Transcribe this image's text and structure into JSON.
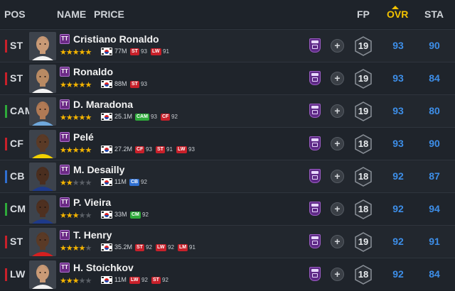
{
  "header": {
    "pos": "POS",
    "name": "NAME",
    "price": "PRICE",
    "fp": "FP",
    "ovr": "OVR",
    "sta": "STA",
    "accent": "#f2c200"
  },
  "colors": {
    "ST": "#c8202a",
    "CF": "#c8202a",
    "LW": "#c8202a",
    "CAM": "#2eaa3a",
    "CM": "#2eaa3a",
    "CB": "#2f6fd0"
  },
  "players": [
    {
      "pos": "ST",
      "name": "Cristiano Ronaldo",
      "stars": 5,
      "price": "77M",
      "alts": [
        {
          "pos": "ST",
          "ovr": "93"
        },
        {
          "pos": "LW",
          "ovr": "91"
        }
      ],
      "fp": "19",
      "ovr": "93",
      "sta": "90",
      "skin": "#c99a76",
      "hair": "#2a1a10",
      "shirt": "#f2f2f2"
    },
    {
      "pos": "ST",
      "name": "Ronaldo",
      "stars": 5,
      "price": "88M",
      "alts": [
        {
          "pos": "ST",
          "ovr": "93"
        }
      ],
      "fp": "19",
      "ovr": "93",
      "sta": "84",
      "skin": "#b88a63",
      "hair": "#b88a63",
      "shirt": "#f2f2f2"
    },
    {
      "pos": "CAM",
      "name": "D. Maradona",
      "stars": 5,
      "price": "25.1M",
      "alts": [
        {
          "pos": "CAM",
          "ovr": "93"
        },
        {
          "pos": "CF",
          "ovr": "92"
        }
      ],
      "fp": "19",
      "ovr": "93",
      "sta": "80",
      "skin": "#b07a55",
      "hair": "#1a120c",
      "shirt": "#6fa8dc"
    },
    {
      "pos": "CF",
      "name": "Pelé",
      "stars": 5,
      "price": "27.2M",
      "alts": [
        {
          "pos": "CF",
          "ovr": "93"
        },
        {
          "pos": "ST",
          "ovr": "91"
        },
        {
          "pos": "LW",
          "ovr": "93"
        }
      ],
      "fp": "18",
      "ovr": "93",
      "sta": "90",
      "skin": "#5a3a26",
      "hair": "#1a1210",
      "shirt": "#f2d000"
    },
    {
      "pos": "CB",
      "name": "M. Desailly",
      "stars": 2,
      "price": "11M",
      "alts": [
        {
          "pos": "CB",
          "ovr": "92"
        }
      ],
      "fp": "18",
      "ovr": "92",
      "sta": "87",
      "skin": "#4a2e1f",
      "hair": "#1a1210",
      "shirt": "#1e3a8a"
    },
    {
      "pos": "CM",
      "name": "P. Vieira",
      "stars": 3,
      "price": "33M",
      "alts": [
        {
          "pos": "CM",
          "ovr": "92"
        }
      ],
      "fp": "18",
      "ovr": "92",
      "sta": "94",
      "skin": "#4e3020",
      "hair": "#1a1210",
      "shirt": "#1e3a8a"
    },
    {
      "pos": "ST",
      "name": "T. Henry",
      "stars": 4,
      "price": "35.2M",
      "alts": [
        {
          "pos": "ST",
          "ovr": "92"
        },
        {
          "pos": "LW",
          "ovr": "92"
        },
        {
          "pos": "LM",
          "ovr": "91"
        }
      ],
      "fp": "19",
      "ovr": "92",
      "sta": "91",
      "skin": "#5a3a26",
      "hair": "#1a1210",
      "shirt": "#d42020"
    },
    {
      "pos": "LW",
      "name": "H. Stoichkov",
      "stars": 3,
      "price": "11M",
      "alts": [
        {
          "pos": "LW",
          "ovr": "92"
        },
        {
          "pos": "ST",
          "ovr": "92"
        }
      ],
      "fp": "18",
      "ovr": "92",
      "sta": "84",
      "skin": "#c99a76",
      "hair": "#3a2818",
      "shirt": "#f2f2f2"
    }
  ]
}
